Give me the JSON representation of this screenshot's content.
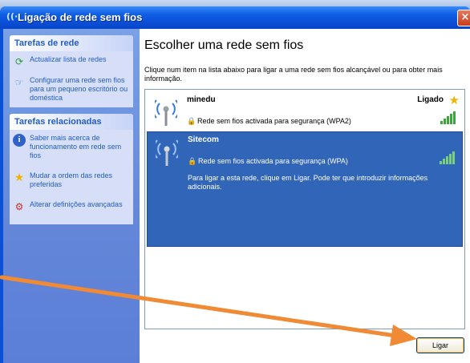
{
  "window": {
    "title": "Ligação de rede sem fios",
    "title_icon": "wifi-icon",
    "close_label": "×"
  },
  "sidebar": {
    "network_tasks": {
      "header": "Tarefas de rede",
      "items": [
        {
          "label": "Actualizar lista de redes",
          "icon": "refresh-icon"
        },
        {
          "label": "Configurar uma rede sem fios para um pequeno escritório ou doméstica",
          "icon": "setup-network-icon"
        }
      ]
    },
    "related_tasks": {
      "header": "Tarefas relacionadas",
      "items": [
        {
          "label": "Saber mais acerca de funcionamento em rede sem fios",
          "icon": "info-icon"
        },
        {
          "label": "Mudar a ordem das redes preferidas",
          "icon": "star-icon"
        },
        {
          "label": "Alterar definições avançadas",
          "icon": "settings-icon"
        }
      ]
    }
  },
  "main": {
    "title": "Escolher uma rede sem fios",
    "description": "Clique num item na lista abaixo para ligar a uma rede sem fios alcançável ou para obter mais informação.",
    "networks": [
      {
        "ssid": "minedu",
        "status": "Ligado",
        "security": "Rede sem fios activada para segurança (WPA2)",
        "signal_level": 5,
        "selected": false
      },
      {
        "ssid": "Sitecom",
        "status": "",
        "security": "Rede sem fios activada para segurança (WPA)",
        "message": "Para ligar a esta rede, clique em Ligar. Pode ter que introduzir informações adicionais.",
        "signal_level": 5,
        "selected": true
      }
    ],
    "connect_button": "Ligar"
  },
  "colors": {
    "titlebar": "#0a4fd6",
    "task_pane": "#6386d9",
    "selection": "#3165b8",
    "link_text": "#215dc6",
    "annotation_arrow": "#f08a34"
  }
}
